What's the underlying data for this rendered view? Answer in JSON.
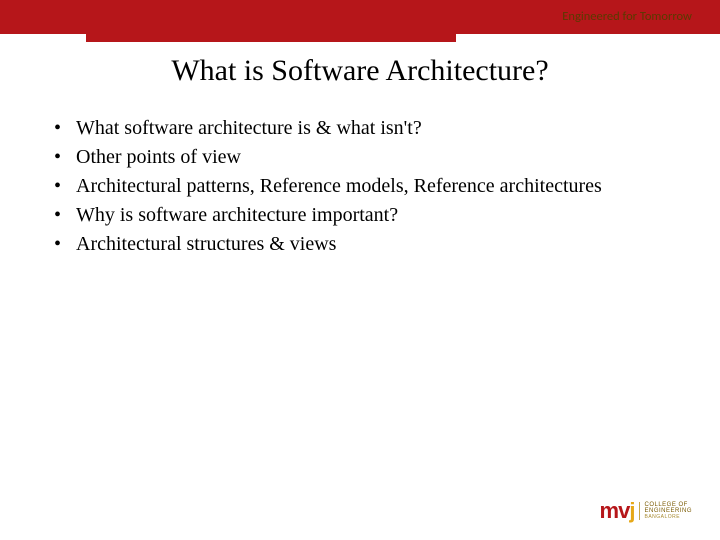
{
  "header": {
    "tagline": "Engineered for Tomorrow"
  },
  "title": "What is Software Architecture?",
  "bullets": [
    "What software architecture is & what isn't?",
    "Other points of view",
    "Architectural patterns, Reference models, Reference architectures",
    "Why is software architecture important?",
    "Architectural structures & views"
  ],
  "logo": {
    "mark_m": "m",
    "mark_v": "v",
    "mark_j": "j",
    "line1": "COLLEGE OF",
    "line2": "ENGINEERING",
    "sub": "BANGALORE"
  }
}
